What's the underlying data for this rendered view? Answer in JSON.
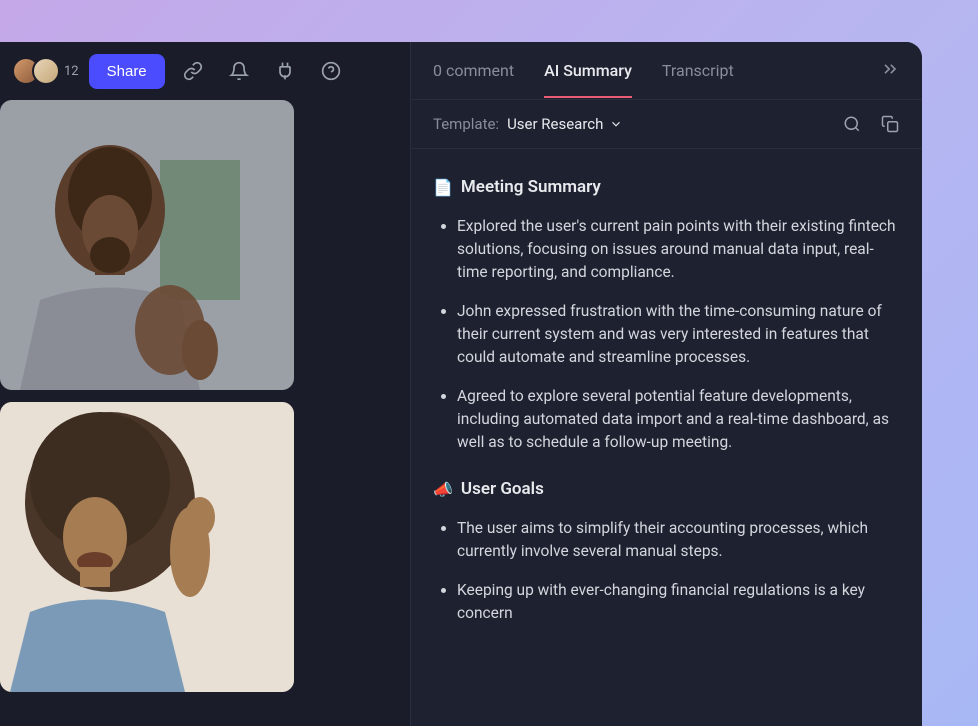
{
  "toolbar": {
    "participant_count": "12",
    "share_label": "Share"
  },
  "tabs": {
    "comment": "0 comment",
    "ai_summary": "AI Summary",
    "transcript": "Transcript"
  },
  "template": {
    "label": "Template:",
    "value": "User Research"
  },
  "summary": {
    "heading": "Meeting Summary",
    "icon": "📄",
    "bullets": [
      "Explored the user's current pain points with their existing fintech solutions, focusing on issues around manual data input, real-time reporting, and compliance.",
      "John expressed frustration with the time-consuming nature of their current system and was very interested in features that could automate and streamline processes.",
      "Agreed to explore several potential feature developments, including automated data import and a real-time dashboard, as well as to schedule a follow-up meeting."
    ]
  },
  "goals": {
    "heading": "User Goals",
    "icon": "📣",
    "bullets": [
      "The user aims to simplify their accounting processes, which currently involve several manual steps.",
      "Keeping up with ever-changing financial regulations is a key concern"
    ]
  }
}
